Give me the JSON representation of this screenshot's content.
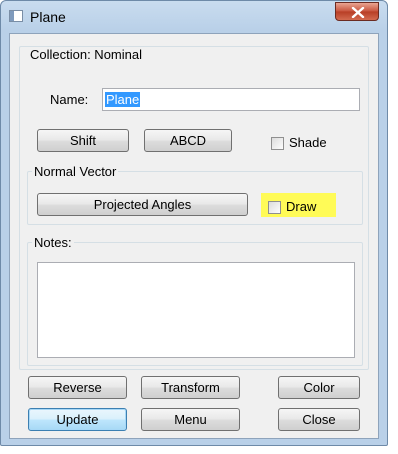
{
  "window": {
    "title": "Plane",
    "close_icon": "close-x-icon"
  },
  "collection": {
    "label": "Collection: Nominal"
  },
  "name": {
    "label": "Name:",
    "value": "Plane"
  },
  "buttons": {
    "shift": "Shift",
    "abcd": "ABCD",
    "projected_angles": "Projected Angles",
    "reverse": "Reverse",
    "transform": "Transform",
    "color": "Color",
    "update": "Update",
    "menu": "Menu",
    "close": "Close"
  },
  "checkboxes": {
    "shade": {
      "label": "Shade",
      "checked": false
    },
    "draw": {
      "label": "Draw",
      "checked": false,
      "highlight_color": "#fffb57"
    }
  },
  "normal_vector": {
    "label": "Normal Vector"
  },
  "notes": {
    "label": "Notes:",
    "value": ""
  },
  "colors": {
    "selection": "#3399ff",
    "default_button_border": "#3c7fb1",
    "close_button": "#c7523b"
  }
}
